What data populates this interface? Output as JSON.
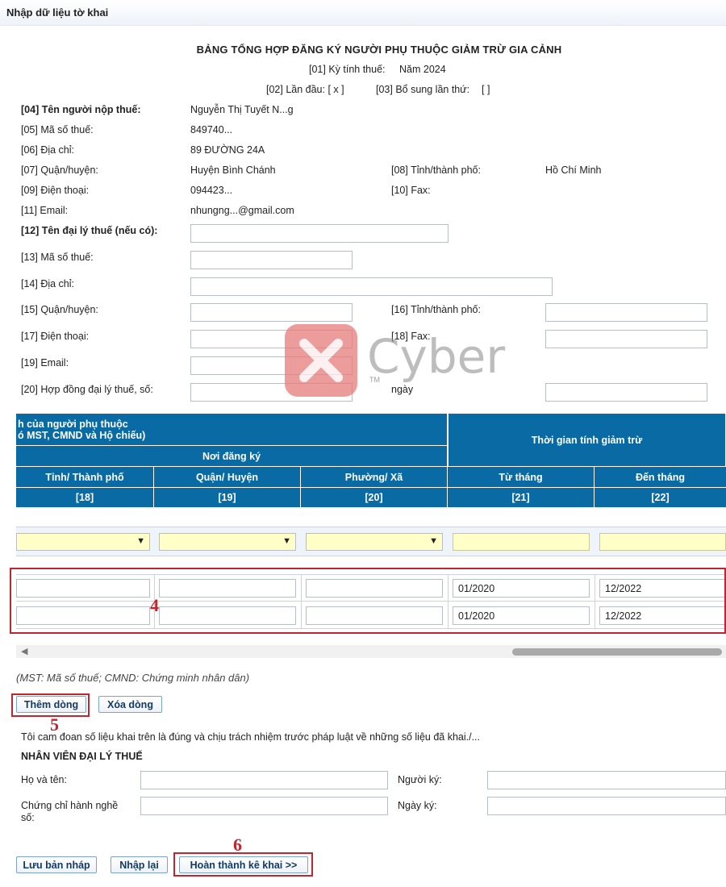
{
  "header": {
    "title": "Nhập dữ liệu tờ khai"
  },
  "form": {
    "title": "BẢNG TỔNG HỢP ĐĂNG KÝ NGƯỜI PHỤ THUỘC GIẢM TRỪ GIA CẢNH",
    "tax_period_label": "[01] Kỳ tính thuế:",
    "tax_period_value": "Năm 2024",
    "first_time": "[02] Lần đầu: [ x ]",
    "supplement": "[03] Bổ sung lần thứ:",
    "supplement_value": "[ ]"
  },
  "taxpayer": {
    "name_label": "[04] Tên người nộp thuế:",
    "name_value": "Nguyễn Thị Tuyết N...g",
    "mst_label": "[05] Mã số thuế:",
    "mst_value": "849740...",
    "address_label": "[06] Địa chỉ:",
    "address_value": "89 ĐƯỜNG 24A",
    "district_label": "[07] Quận/huyện:",
    "district_value": "Huyện Bình Chánh",
    "province_label": "[08] Tỉnh/thành phố:",
    "province_value": "Hồ Chí Minh",
    "phone_label": "[09] Điện thoại:",
    "phone_value": "094423...",
    "fax_label": "[10] Fax:",
    "email_label": "[11] Email:",
    "email_value": "nhungng...@gmail.com"
  },
  "agent": {
    "name_label": "[12] Tên đại lý thuế (nếu có):",
    "mst_label": "[13] Mã số thuế:",
    "address_label": "[14] Địa chỉ:",
    "district_label": "[15] Quận/huyện:",
    "province_label": "[16] Tỉnh/thành phố:",
    "phone_label": "[17] Điện thoại:",
    "fax_label": "[18] Fax:",
    "email_label": "[19] Email:",
    "contract_label": "[20] Hợp đồng đại lý thuế, số:",
    "date_label": "ngày"
  },
  "watermark": {
    "text": "Cyber",
    "tm": "TM"
  },
  "table": {
    "partial_header_1": "h của người phụ thuộc",
    "partial_header_2": "ó MST, CMND và Hộ chiếu)",
    "group_registration": "Nơi đăng ký",
    "group_period": "Thời gian tính giảm trừ",
    "columns": [
      {
        "label": "Tỉnh/ Thành phố",
        "code": "[18]"
      },
      {
        "label": "Quận/ Huyện",
        "code": "[19]"
      },
      {
        "label": "Phường/ Xã",
        "code": "[20]"
      },
      {
        "label": "Từ tháng",
        "code": "[21]"
      },
      {
        "label": "Đến tháng",
        "code": "[22]"
      }
    ],
    "rows": [
      {
        "from": "01/2020",
        "to": "12/2022"
      },
      {
        "from": "01/2020",
        "to": "12/2022"
      }
    ]
  },
  "annotations": {
    "a4": "4",
    "a5": "5",
    "a6": "6"
  },
  "note": "(MST: Mã số thuế; CMND: Chứng minh nhân dân)",
  "buttons": {
    "add_row": "Thêm dòng",
    "delete_row": "Xóa dòng",
    "save_draft": "Lưu bản nháp",
    "reset": "Nhập lại",
    "complete": "Hoàn thành kê khai >>"
  },
  "declaration": "Tôi cam đoan số liệu khai trên là đúng và chịu trách nhiệm trước pháp luật về những số liệu đã khai./...",
  "agent_staff": {
    "title": "NHÂN VIÊN ĐẠI LÝ THUẾ",
    "fullname_label": "Họ và tên:",
    "signer_label": "Người ký:",
    "cert_label_1": "Chứng chỉ hành nghề",
    "cert_label_2": "số:",
    "sign_date_label": "Ngày ký:"
  }
}
